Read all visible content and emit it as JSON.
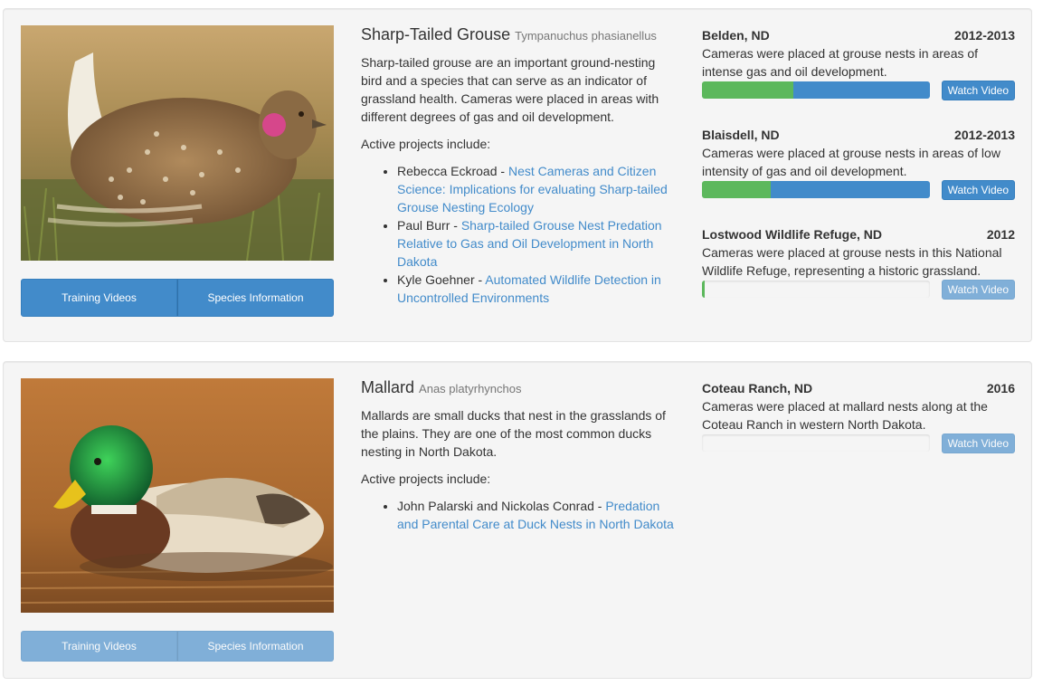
{
  "species": [
    {
      "common_name": "Sharp-Tailed Grouse",
      "scientific_name": "Tympanuchus phasianellus",
      "description": "Sharp-tailed grouse are an important ground-nesting bird and a species that can serve as an indicator of grassland health. Cameras were placed in areas with different degrees of gas and oil development.",
      "projects_label": "Active projects include:",
      "projects": [
        {
          "author": "Rebecca Eckroad - ",
          "title": "Nest Cameras and Citizen Science: Implications for evaluating Sharp-tailed Grouse Nesting Ecology"
        },
        {
          "author": "Paul Burr - ",
          "title": "Sharp-tailed Grouse Nest Predation Relative to Gas and Oil Development in North Dakota"
        },
        {
          "author": "Kyle Goehner - ",
          "title": "Automated Wildlife Detection in Uncontrolled Environments"
        }
      ],
      "buttons": {
        "training": "Training Videos",
        "info": "Species Information",
        "disabled": false
      },
      "sites": [
        {
          "name": "Belden, ND",
          "years": "2012-2013",
          "description": "Cameras were placed at grouse nests in areas of intense gas and oil development.",
          "progress_success": 40,
          "progress_primary": 60,
          "watch_label": "Watch Video",
          "watch_disabled": false
        },
        {
          "name": "Blaisdell, ND",
          "years": "2012-2013",
          "description": "Cameras were placed at grouse nests in areas of low intensity of gas and oil development.",
          "progress_success": 30,
          "progress_primary": 70,
          "watch_label": "Watch Video",
          "watch_disabled": false
        },
        {
          "name": "Lostwood Wildlife Refuge, ND",
          "years": "2012",
          "description": "Cameras were placed at grouse nests in this National Wildlife Refuge, representing a historic grassland.",
          "progress_success": 1,
          "progress_primary": 0,
          "watch_label": "Watch Video",
          "watch_disabled": true
        }
      ]
    },
    {
      "common_name": "Mallard",
      "scientific_name": "Anas platyrhynchos",
      "description": "Mallards are small ducks that nest in the grasslands of the plains. They are one of the most common ducks nesting in North Dakota.",
      "projects_label": "Active projects include:",
      "projects": [
        {
          "author": "John Palarski and Nickolas Conrad - ",
          "title": "Predation and Parental Care at Duck Nests in North Dakota"
        }
      ],
      "buttons": {
        "training": "Training Videos",
        "info": "Species Information",
        "disabled": true
      },
      "sites": [
        {
          "name": "Coteau Ranch, ND",
          "years": "2016",
          "description": "Cameras were placed at mallard nests along at the Coteau Ranch in western North Dakota.",
          "progress_success": 0,
          "progress_primary": 0,
          "watch_label": "Watch Video",
          "watch_disabled": true
        }
      ]
    }
  ],
  "colors": {
    "primary": "#428bca",
    "success": "#5cb85c",
    "link": "#428bca"
  },
  "icons": {
    "grouse_photo": "sharp-tailed-grouse-photo",
    "mallard_photo": "mallard-photo"
  }
}
